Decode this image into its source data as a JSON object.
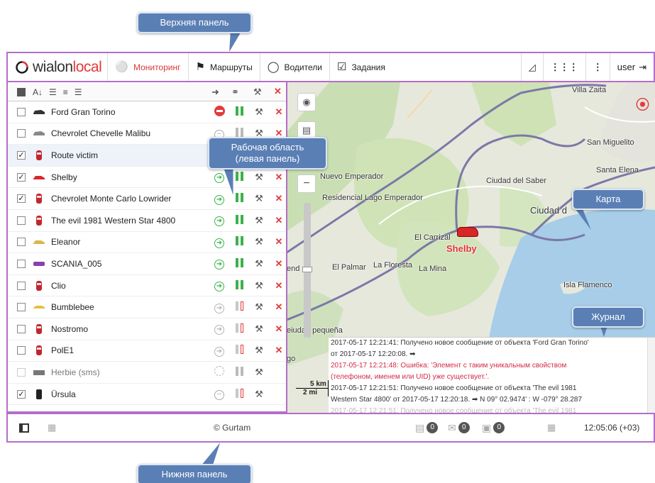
{
  "callouts": {
    "top_panel": "Верхняя панель",
    "work_area": "Рабочая область (левая панель)",
    "map": "Карта",
    "log": "Журнал",
    "bottom_panel": "Нижняя панель"
  },
  "topbar": {
    "logo": "wialonlocal",
    "nav": [
      {
        "label": "Мониторинг",
        "icon": "globe-icon",
        "active": true
      },
      {
        "label": "Маршруты",
        "icon": "route-icon",
        "active": false
      },
      {
        "label": "Водители",
        "icon": "driver-icon",
        "active": false
      },
      {
        "label": "Задания",
        "icon": "tasks-icon",
        "active": false
      }
    ],
    "user": "user"
  },
  "units": [
    {
      "name": "Ford Gran Torino",
      "checked": false,
      "icon": "car-dark",
      "state": "stop",
      "bars": "green",
      "sel": false
    },
    {
      "name": "Chevrolet Chevelle Malibu",
      "checked": false,
      "icon": "car-grey",
      "state": "minus",
      "bars": "grey",
      "sel": false
    },
    {
      "name": "Route victim",
      "checked": true,
      "icon": "car-red-top",
      "state": "none",
      "bars": "none",
      "sel": true
    },
    {
      "name": "Shelby",
      "checked": true,
      "icon": "car-red",
      "state": "green",
      "bars": "green",
      "sel": false
    },
    {
      "name": "Chevrolet Monte Carlo Lowrider",
      "checked": true,
      "icon": "car-red-top",
      "state": "green",
      "bars": "green",
      "sel": false
    },
    {
      "name": "The evil 1981 Western Star 4800",
      "checked": false,
      "icon": "car-red-top",
      "state": "green",
      "bars": "green",
      "sel": false
    },
    {
      "name": "Eleanor",
      "checked": false,
      "icon": "car-yellow",
      "state": "green",
      "bars": "green",
      "sel": false
    },
    {
      "name": "SCANIA_005",
      "checked": false,
      "icon": "truck-purple",
      "state": "green",
      "bars": "green",
      "sel": false
    },
    {
      "name": "Clio",
      "checked": false,
      "icon": "car-red-top",
      "state": "green",
      "bars": "green",
      "sel": false
    },
    {
      "name": "Bumblebee",
      "checked": false,
      "icon": "car-yellow-slim",
      "state": "grey",
      "bars": "red",
      "sel": false
    },
    {
      "name": "Nostromo",
      "checked": false,
      "icon": "car-red-top",
      "state": "grey",
      "bars": "red",
      "sel": false
    },
    {
      "name": "PolE1",
      "checked": false,
      "icon": "car-red-top",
      "state": "grey",
      "bars": "red",
      "sel": false
    },
    {
      "name": "Herbie (sms)",
      "checked": false,
      "icon": "car-sms",
      "state": "dashed",
      "bars": "greyall",
      "sel": false,
      "dim": true
    },
    {
      "name": "Ürsula",
      "checked": true,
      "icon": "car-phone",
      "state": "minus",
      "bars": "red",
      "sel": false
    }
  ],
  "map": {
    "labels": {
      "villa_zaita": "Villa Zaita",
      "san_miguelito": "San Miguelito",
      "santa_elena": "Santa Elena",
      "nuevo_emperador": "Nuevo Emperador",
      "ciudad_saber": "Ciudad del Saber",
      "residencial": "Residencial Lago Emperador",
      "ciudad": "Ciudad d",
      "el_carrizal": "El Carrizal",
      "shelby": "Shelby",
      "el_palmar": "El Palmar",
      "la_floresta": "La Floresta",
      "la_mina": "La Mina",
      "end": "end",
      "isla_flamenco": "Isla Flamenco",
      "ciudad_pequena": "eiudad pequeña",
      "scale_km": "5 km",
      "scale_mi": "2 mi",
      "go": "go"
    },
    "log": [
      {
        "type": "msg",
        "text": "2017-05-17 12:21:41: Получено новое сообщение от объекта 'Ford Gran Torino'"
      },
      {
        "type": "msg",
        "text": "от 2017-05-17 12:20:08. ➡"
      },
      {
        "type": "err",
        "text": "2017-05-17 12:21:48: Ошибка: 'Элемент с таким уникальным свойством"
      },
      {
        "type": "err",
        "text": "(телефоном, именем или UID) уже существует.'."
      },
      {
        "type": "msg",
        "text": "2017-05-17 12:21:51: Получено новое сообщение от объекта 'The evil 1981"
      },
      {
        "type": "msg",
        "text": "Western Star 4800' от 2017-05-17 12:20:18. ➡ N 09° 02.9474' : W -079° 28.287"
      },
      {
        "type": "ghost",
        "text": "2017-05-17 12:21:51: Получено новое сообщение от объекта 'The evil 1981"
      }
    ]
  },
  "bottombar": {
    "copyright": "© Gurtam",
    "count1": "0",
    "count2": "0",
    "count3": "0",
    "time": "12:05:06 (+03)"
  },
  "colors": {
    "accent": "#e23b3b",
    "frame": "#b46ec9",
    "callout": "#5a7fb5",
    "green": "#3db14a"
  }
}
